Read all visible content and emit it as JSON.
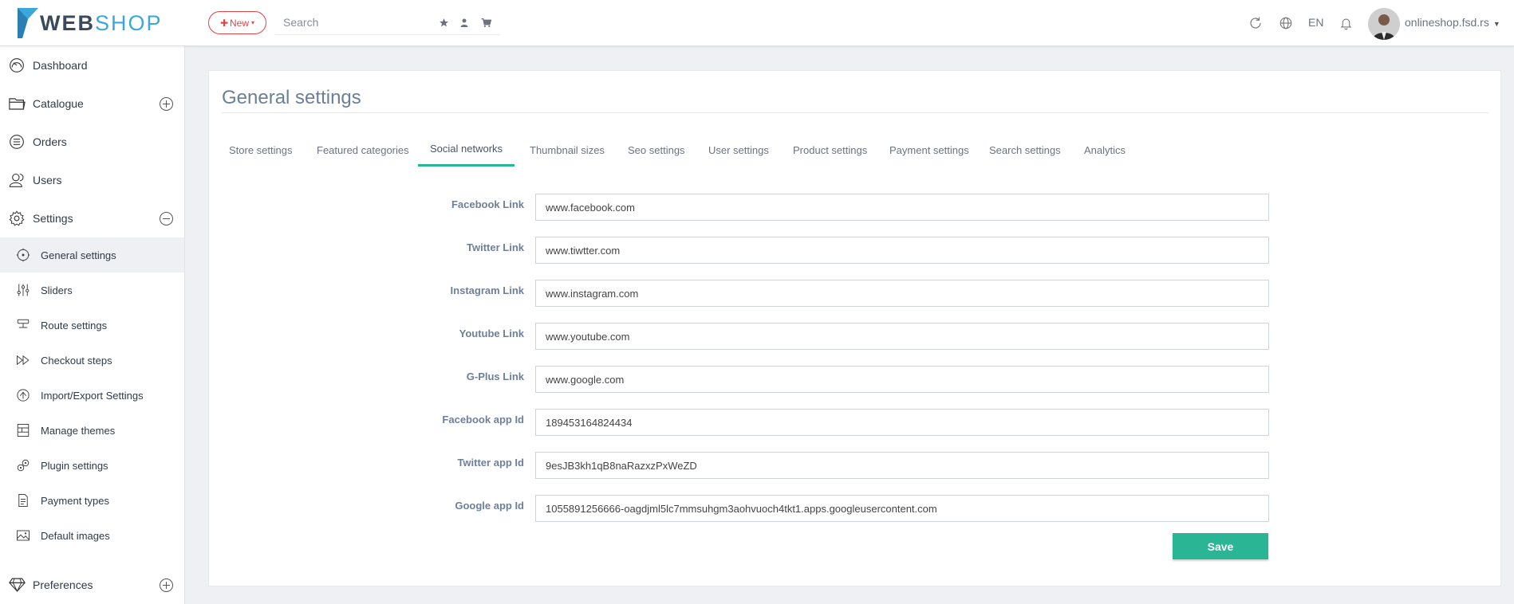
{
  "brand": {
    "name_part1": "WEB",
    "name_part2": "SHOP",
    "accent": "#3aa8db",
    "dark": "#3a4a5c"
  },
  "header": {
    "new_label": "New",
    "search_placeholder": "Search",
    "language": "EN",
    "account": "onlineshop.fsd.rs",
    "icons": [
      "star-icon",
      "user-icon",
      "cart-icon",
      "refresh-icon",
      "globe-icon",
      "bell-icon"
    ]
  },
  "sidebar": {
    "main": [
      {
        "label": "Dashboard",
        "icon": "dashboard-icon"
      },
      {
        "label": "Catalogue",
        "icon": "folder-icon",
        "toggle": "expand"
      },
      {
        "label": "Orders",
        "icon": "list-icon"
      },
      {
        "label": "Users",
        "icon": "users-icon"
      },
      {
        "label": "Settings",
        "icon": "gear-icon",
        "toggle": "collapse"
      }
    ],
    "settings_sub": [
      {
        "label": "General settings",
        "icon": "general-settings-icon",
        "active": true
      },
      {
        "label": "Sliders",
        "icon": "sliders-icon"
      },
      {
        "label": "Route settings",
        "icon": "route-icon"
      },
      {
        "label": "Checkout steps",
        "icon": "checkout-steps-icon"
      },
      {
        "label": "Import/Export Settings",
        "icon": "import-export-icon"
      },
      {
        "label": "Manage themes",
        "icon": "themes-icon"
      },
      {
        "label": "Plugin settings",
        "icon": "plugin-icon"
      },
      {
        "label": "Payment types",
        "icon": "payment-icon"
      },
      {
        "label": "Default images",
        "icon": "image-icon"
      }
    ],
    "bottom": [
      {
        "label": "Preferences",
        "icon": "diamond-icon",
        "toggle": "expand"
      }
    ]
  },
  "main": {
    "title": "General settings",
    "tabs": [
      {
        "label": "Store settings"
      },
      {
        "label": "Featured categories"
      },
      {
        "label": "Social networks",
        "active": true
      },
      {
        "label": "Thumbnail sizes"
      },
      {
        "label": "Seo settings"
      },
      {
        "label": "User settings"
      },
      {
        "label": "Product settings"
      },
      {
        "label": "Payment settings"
      },
      {
        "label": "Search settings"
      },
      {
        "label": "Analytics"
      }
    ],
    "fields": [
      {
        "label": "Facebook Link",
        "value": "www.facebook.com"
      },
      {
        "label": "Twitter Link",
        "value": "www.tiwtter.com"
      },
      {
        "label": "Instagram Link",
        "value": "www.instagram.com"
      },
      {
        "label": "Youtube Link",
        "value": "www.youtube.com"
      },
      {
        "label": "G-Plus Link",
        "value": "www.google.com"
      },
      {
        "label": "Facebook app Id",
        "value": "189453164824434"
      },
      {
        "label": "Twitter app Id",
        "value": "9esJB3kh1qB8naRazxzPxWeZD"
      },
      {
        "label": "Google app Id",
        "value": "1055891256666-oagdjml5lc7mmsuhgm3aohvuoch4tkt1.apps.googleusercontent.com"
      }
    ],
    "save_label": "Save",
    "accent": "#2ab594"
  }
}
